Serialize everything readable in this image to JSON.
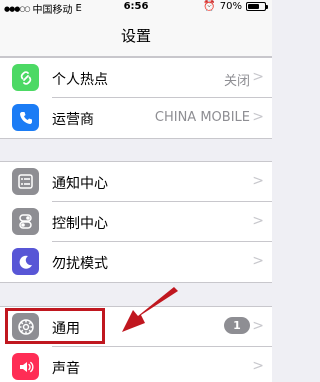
{
  "status_bar": {
    "carrier": "中国移动",
    "network": "E",
    "time": "6:56",
    "battery_percent": "70%",
    "battery_level": 0.7
  },
  "nav": {
    "title": "设置"
  },
  "groups": [
    {
      "rows": [
        {
          "label": "个人热点",
          "value": "关闭",
          "icon": "hotspot-icon",
          "color": "#4cd964"
        },
        {
          "label": "运营商",
          "value": "CHINA MOBILE",
          "icon": "phone-icon",
          "color": "#1b7cf5"
        }
      ]
    },
    {
      "rows": [
        {
          "label": "通知中心",
          "icon": "notification-center-icon",
          "color": "#8e8e93"
        },
        {
          "label": "控制中心",
          "icon": "control-center-icon",
          "color": "#8e8e93"
        },
        {
          "label": "勿扰模式",
          "icon": "moon-icon",
          "color": "#5856d6"
        }
      ]
    },
    {
      "rows": [
        {
          "label": "通用",
          "badge": "1",
          "icon": "gear-icon",
          "color": "#8e8e93"
        },
        {
          "label": "声音",
          "icon": "speaker-icon",
          "color": "#ff2d55"
        }
      ]
    }
  ],
  "annotation_color": "#c0171f"
}
